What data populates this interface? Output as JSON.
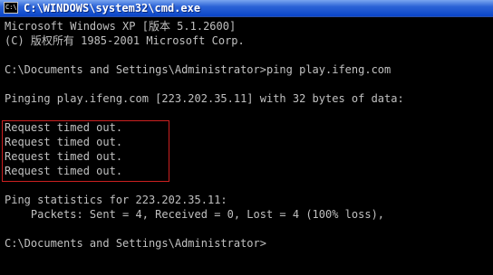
{
  "window": {
    "title": "C:\\WINDOWS\\system32\\cmd.exe",
    "icon_label": "C:\\"
  },
  "console": {
    "lines": [
      "Microsoft Windows XP [版本 5.1.2600]",
      "(C) 版权所有 1985-2001 Microsoft Corp.",
      "",
      "C:\\Documents and Settings\\Administrator>ping play.ifeng.com",
      "",
      "Pinging play.ifeng.com [223.202.35.11] with 32 bytes of data:",
      "",
      "Request timed out.",
      "Request timed out.",
      "Request timed out.",
      "Request timed out.",
      "",
      "Ping statistics for 223.202.35.11:",
      "    Packets: Sent = 4, Received = 0, Lost = 4 (100% loss),",
      "",
      "C:\\Documents and Settings\\Administrator>"
    ]
  },
  "colors": {
    "background": "#000000",
    "text": "#c0c0c0",
    "highlight_border": "#cc2020"
  }
}
